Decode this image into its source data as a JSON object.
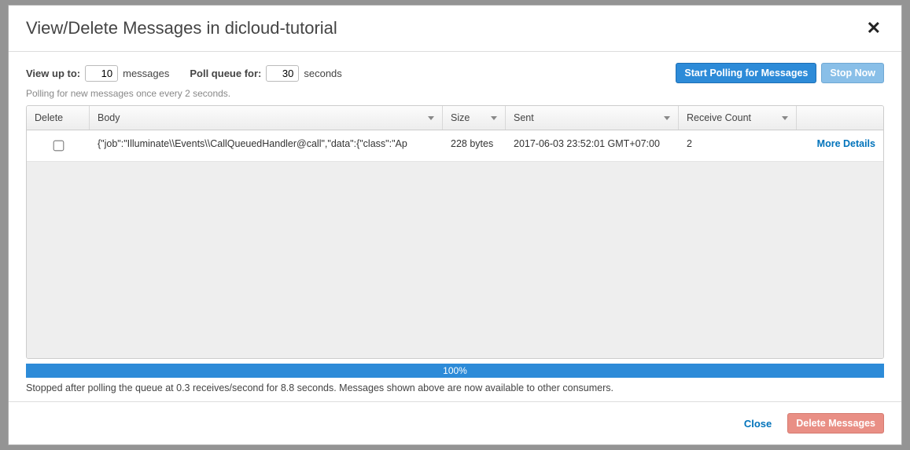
{
  "header": {
    "title": "View/Delete Messages in dicloud-tutorial"
  },
  "controls": {
    "view_up_to_label": "View up to:",
    "view_up_to_value": "10",
    "messages_unit": "messages",
    "poll_queue_label": "Poll queue for:",
    "poll_queue_value": "30",
    "seconds_unit": "seconds",
    "hint": "Polling for new messages once every 2 seconds.",
    "start_polling_label": "Start Polling for Messages",
    "stop_now_label": "Stop Now"
  },
  "columns": {
    "delete": "Delete",
    "body": "Body",
    "size": "Size",
    "sent": "Sent",
    "receive_count": "Receive Count"
  },
  "rows": [
    {
      "checked": false,
      "body": "{\"job\":\"Illuminate\\\\Events\\\\CallQueuedHandler@call\",\"data\":{\"class\":\"Ap",
      "size": "228 bytes",
      "sent": "2017-06-03 23:52:01 GMT+07:00",
      "receive_count": "2",
      "details": "More Details"
    }
  ],
  "progress": {
    "percent_text": "100%",
    "width_percent": 100
  },
  "status_line": "Stopped after polling the queue at 0.3 receives/second for 8.8 seconds. Messages shown above are now available to other consumers.",
  "footer": {
    "close_label": "Close",
    "delete_label": "Delete Messages"
  }
}
